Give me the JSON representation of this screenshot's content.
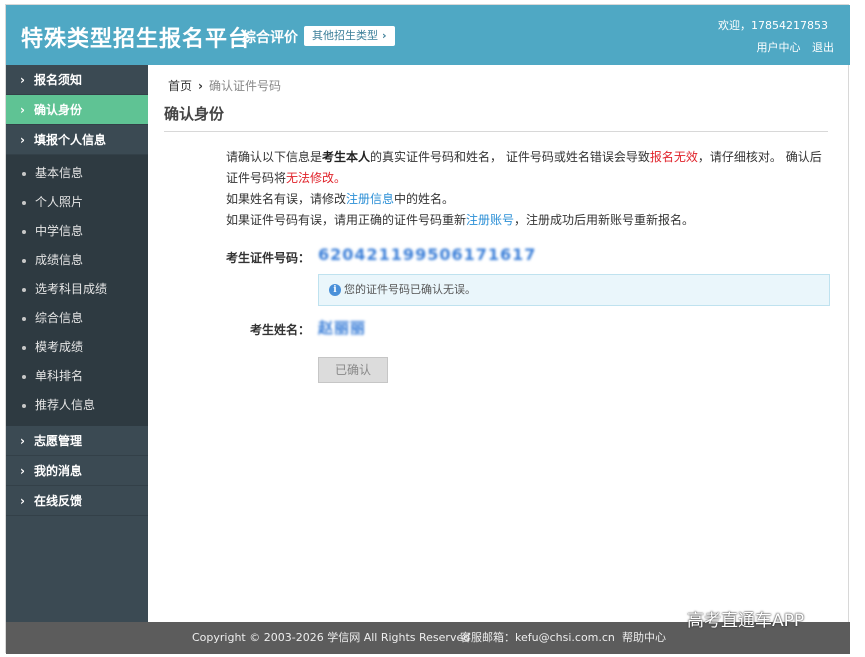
{
  "header": {
    "title": "特殊类型招生报名平台",
    "subtitle": "综合评价",
    "type_switch_label": "其他招生类型",
    "welcome": "欢迎，17854217853",
    "user_center": "用户中心",
    "logout": "退出"
  },
  "sidebar": {
    "items": [
      {
        "label": "报名须知"
      },
      {
        "label": "确认身份"
      },
      {
        "label": "填报个人信息"
      }
    ],
    "sub_items": [
      {
        "label": "基本信息"
      },
      {
        "label": "个人照片"
      },
      {
        "label": "中学信息"
      },
      {
        "label": "成绩信息"
      },
      {
        "label": "选考科目成绩"
      },
      {
        "label": "综合信息"
      },
      {
        "label": "模考成绩"
      },
      {
        "label": "单科排名"
      },
      {
        "label": "推荐人信息"
      }
    ],
    "bottom_items": [
      {
        "label": "志愿管理"
      },
      {
        "label": "我的消息"
      },
      {
        "label": "在线反馈"
      }
    ]
  },
  "breadcrumb": {
    "home": "首页",
    "current": "确认证件号码"
  },
  "page_title": "确认身份",
  "notice": {
    "p1_a": "请确认以下信息是",
    "p1_b": "考生本人",
    "p1_c": "的真实证件号码和姓名，  证件号码或姓名错误会导致",
    "p1_d": "报名无效",
    "p1_e": "，请仔细核对。  确认后证件号码将",
    "p1_f": "无法修改。",
    "p2_a": "如果姓名有误，请修改",
    "p2_link": "注册信息",
    "p2_b": "中的姓名。",
    "p3_a": "如果证件号码有误，请用正确的证件号码重新",
    "p3_link": "注册账号",
    "p3_b": "，注册成功后用新账号重新报名。"
  },
  "form": {
    "id_label": "考生证件号码：",
    "id_value": "620421199506171617",
    "id_info": "您的证件号码已确认无误。",
    "name_label": "考生姓名：",
    "name_value": "赵丽丽",
    "confirmed_button": "已确认"
  },
  "footer": {
    "copyright": "Copyright © 2003-2026 学信网 All Rights Reserved",
    "email": "客服邮箱：kefu@chsi.com.cn",
    "help": "帮助中心"
  },
  "watermark": "高考直通车APP",
  "colors": {
    "header_bg": "#4fa8c4",
    "sidebar_bg": "#3b4a53",
    "active_item": "#5fc394",
    "warning_red": "#e0232b",
    "link_blue": "#2b8fd6"
  }
}
